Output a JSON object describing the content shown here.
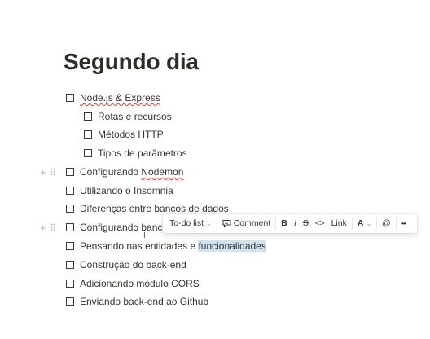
{
  "page": {
    "title": "Segundo dia"
  },
  "todos": [
    {
      "label": "Node.js & Express"
    },
    {
      "label": "Rotas e recursos"
    },
    {
      "label": "Métodos HTTP"
    },
    {
      "label": "Tipos de parâmetros"
    },
    {
      "label_pre": "Configurando ",
      "label_word": "Nodemon"
    },
    {
      "label": "Utilizando o Insomnia"
    },
    {
      "label": "Diferenças entre bancos de dados"
    },
    {
      "label": "Configurando banco"
    },
    {
      "label_pre": "Pensando nas entidades e ",
      "label_sel": "funcionalidades"
    },
    {
      "label": "Construção do back-end"
    },
    {
      "label": "Adicionando módulo CORS"
    },
    {
      "label": "Enviando back-end ao Github"
    }
  ],
  "toolbar": {
    "block_type": "To-do list",
    "comment": "Comment",
    "bold": "B",
    "italic": "i",
    "strike": "S",
    "code": "<>",
    "link": "Link",
    "color": "A",
    "mention": "@",
    "more": "•••"
  },
  "icons": [
    "plus-icon",
    "drag-handle-icon",
    "chevron-down-icon",
    "comment-icon",
    "mention-icon",
    "more-icon",
    "text-cursor-icon"
  ]
}
